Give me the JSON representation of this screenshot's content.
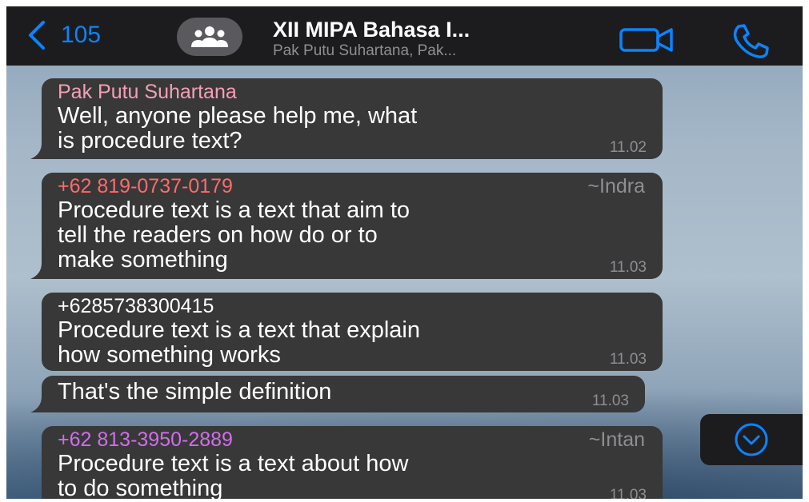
{
  "header": {
    "back_count": "105",
    "title": "XII MIPA Bahasa I...",
    "subtitle": "Pak Putu Suhartana, Pak..."
  },
  "messages": [
    {
      "sender": "Pak Putu Suhartana",
      "alias": "",
      "lines": [
        "Well, anyone please help me, what",
        "is procedure text?"
      ],
      "time": "11.02"
    },
    {
      "sender": "+62 819-0737-0179",
      "alias": "~Indra",
      "lines": [
        "Procedure text is a text that aim to",
        "tell the readers on how  do or to",
        "make something"
      ],
      "time": "11.03"
    },
    {
      "sender": "+6285738300415",
      "alias": "",
      "lines": [
        "Procedure text is a text that explain",
        "how something works"
      ],
      "time": "11.03"
    },
    {
      "sender": "",
      "alias": "",
      "lines": [
        "That's the simple definition"
      ],
      "time": "11.03"
    },
    {
      "sender": "+62 813-3950-2889",
      "alias": "~Intan",
      "lines": [
        "Procedure text is a text about how",
        "to do something"
      ],
      "time": "11.03"
    }
  ],
  "colors": {
    "header_bg": "#1c1c1e",
    "accent": "#0a84ff",
    "bubble_bg": "#383839",
    "meta_text": "#8e8e93",
    "sender_1": "#f4a0b4",
    "sender_2": "#ff6b6b",
    "sender_3": "#ffffff",
    "sender_5": "#cf6fe8"
  },
  "icons": [
    "chevron-left-icon",
    "group-avatar-icon",
    "video-call-icon",
    "phone-icon",
    "scroll-down-icon"
  ]
}
